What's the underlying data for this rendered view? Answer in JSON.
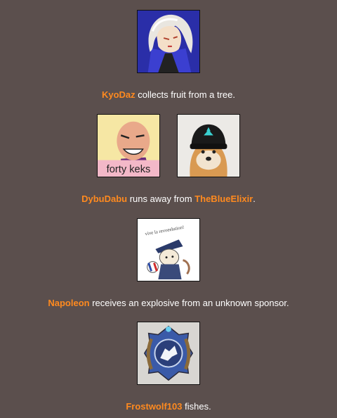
{
  "events": [
    {
      "avatars": [
        {
          "icon": "anime-woman-white-hair-icon"
        }
      ],
      "actor": "KyoDaz",
      "text": " collects fruit from a tree."
    },
    {
      "avatars": [
        {
          "icon": "bald-villain-forty-keks-icon",
          "caption": "forty keks"
        },
        {
          "icon": "shiba-dog-beanie-icon"
        }
      ],
      "actor": "DybuDabu",
      "text": " runs away from ",
      "target": "TheBlueElixir",
      "suffix": "."
    },
    {
      "avatars": [
        {
          "icon": "napoleon-bunny-sketch-icon",
          "caption": "vive la revoeelution!"
        }
      ],
      "actor": "Napoleon",
      "text": " receives an explosive from an unknown sponsor."
    },
    {
      "avatars": [
        {
          "icon": "frostwolf-emblem-icon"
        }
      ],
      "actor": "Frostwolf103",
      "text": " fishes."
    }
  ],
  "colors": {
    "background": "#5b4f4d",
    "name": "#ff8a1f",
    "text": "#ffffff"
  }
}
